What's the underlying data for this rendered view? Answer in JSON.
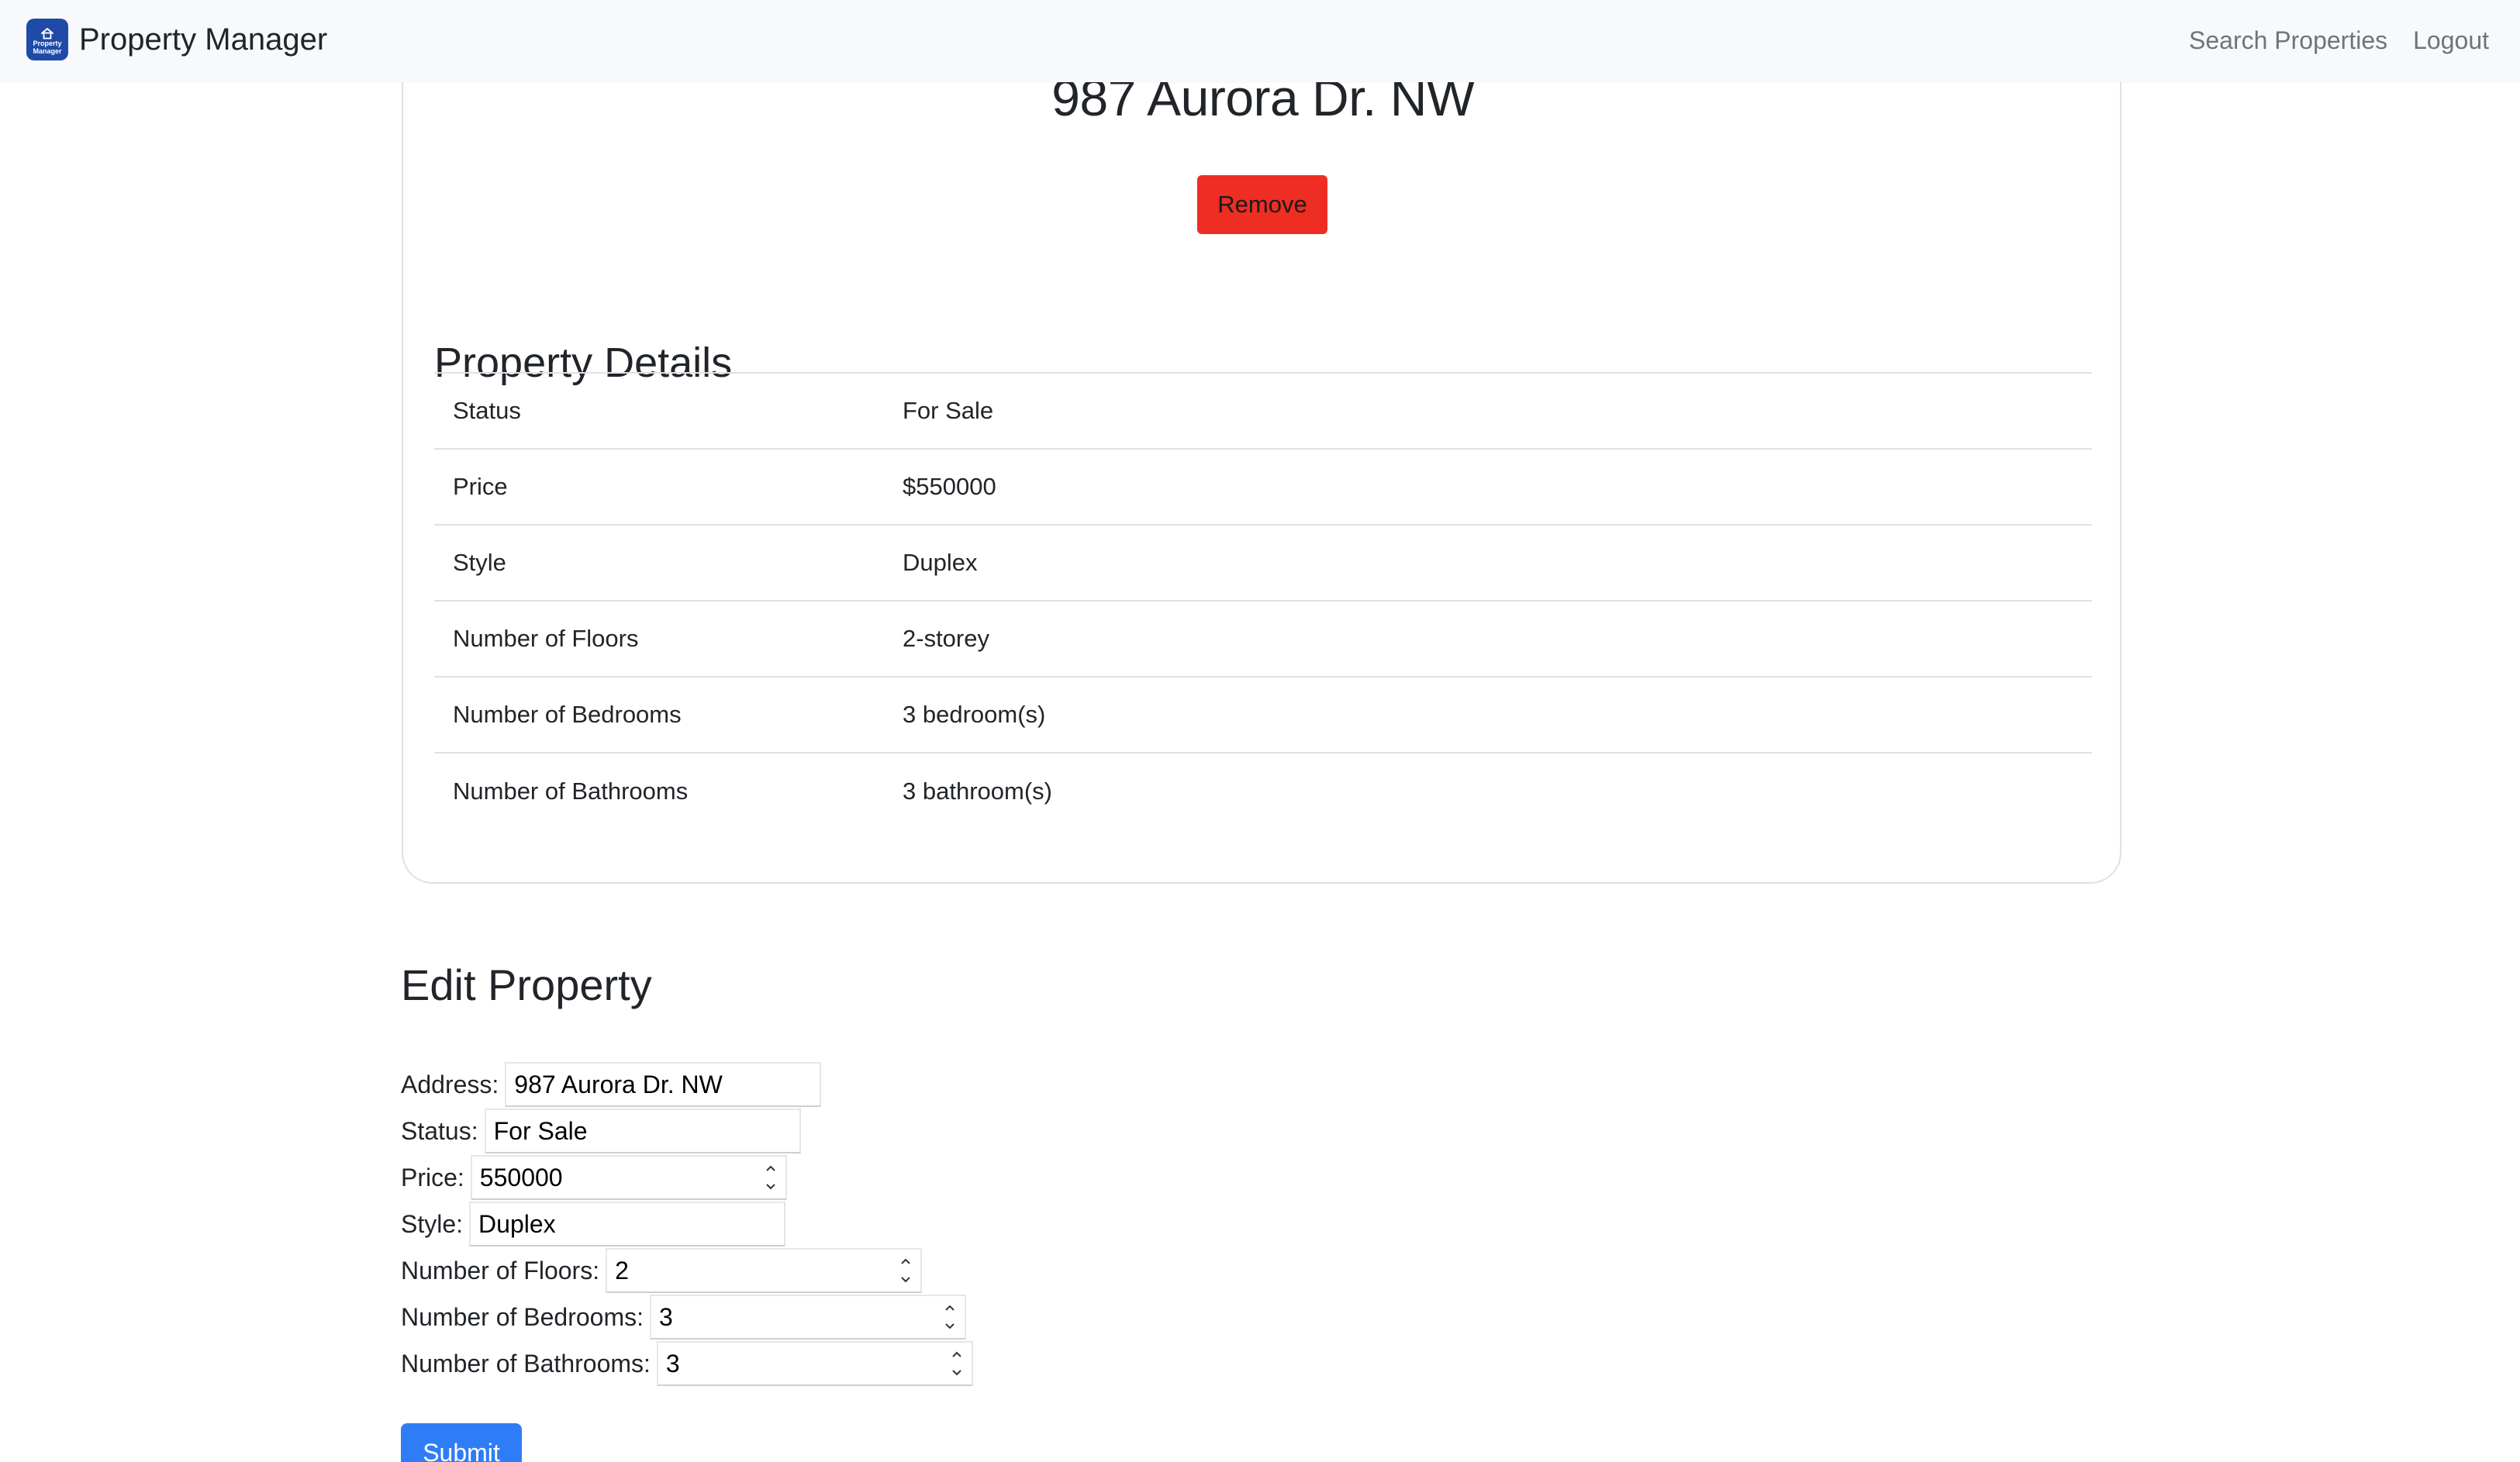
{
  "navbar": {
    "logo_text_line1": "Property",
    "logo_text_line2": "Manager",
    "brand": "Property Manager",
    "links": [
      "Search Properties",
      "Logout"
    ]
  },
  "property": {
    "title": "987 Aurora Dr. NW",
    "remove_label": "Remove"
  },
  "details": {
    "heading": "Property Details",
    "rows": [
      {
        "label": "Status",
        "value": "For Sale"
      },
      {
        "label": "Price",
        "value": "$550000"
      },
      {
        "label": "Style",
        "value": "Duplex"
      },
      {
        "label": "Number of Floors",
        "value": "2-storey"
      },
      {
        "label": "Number of Bedrooms",
        "value": "3 bedroom(s)"
      },
      {
        "label": "Number of Bathrooms",
        "value": "3 bathroom(s)"
      }
    ]
  },
  "edit": {
    "heading": "Edit Property",
    "fields": {
      "address": {
        "label": "Address:",
        "value": "987 Aurora Dr. NW"
      },
      "status": {
        "label": "Status:",
        "value": "For Sale"
      },
      "price": {
        "label": "Price:",
        "value": "550000"
      },
      "style": {
        "label": "Style:",
        "value": "Duplex"
      },
      "floors": {
        "label": "Number of Floors:",
        "value": "2"
      },
      "bedrooms": {
        "label": "Number of Bedrooms:",
        "value": "3"
      },
      "bathrooms": {
        "label": "Number of Bathrooms:",
        "value": "3"
      }
    },
    "submit_label": "Submit"
  },
  "colors": {
    "remove_button": "#ee2d23",
    "submit_button": "#2f7df6",
    "logo_background": "#1f4aa8",
    "navbar_background": "#f8f9fa"
  },
  "icons": [
    "house-icon",
    "spinner-up-icon",
    "spinner-down-icon"
  ]
}
